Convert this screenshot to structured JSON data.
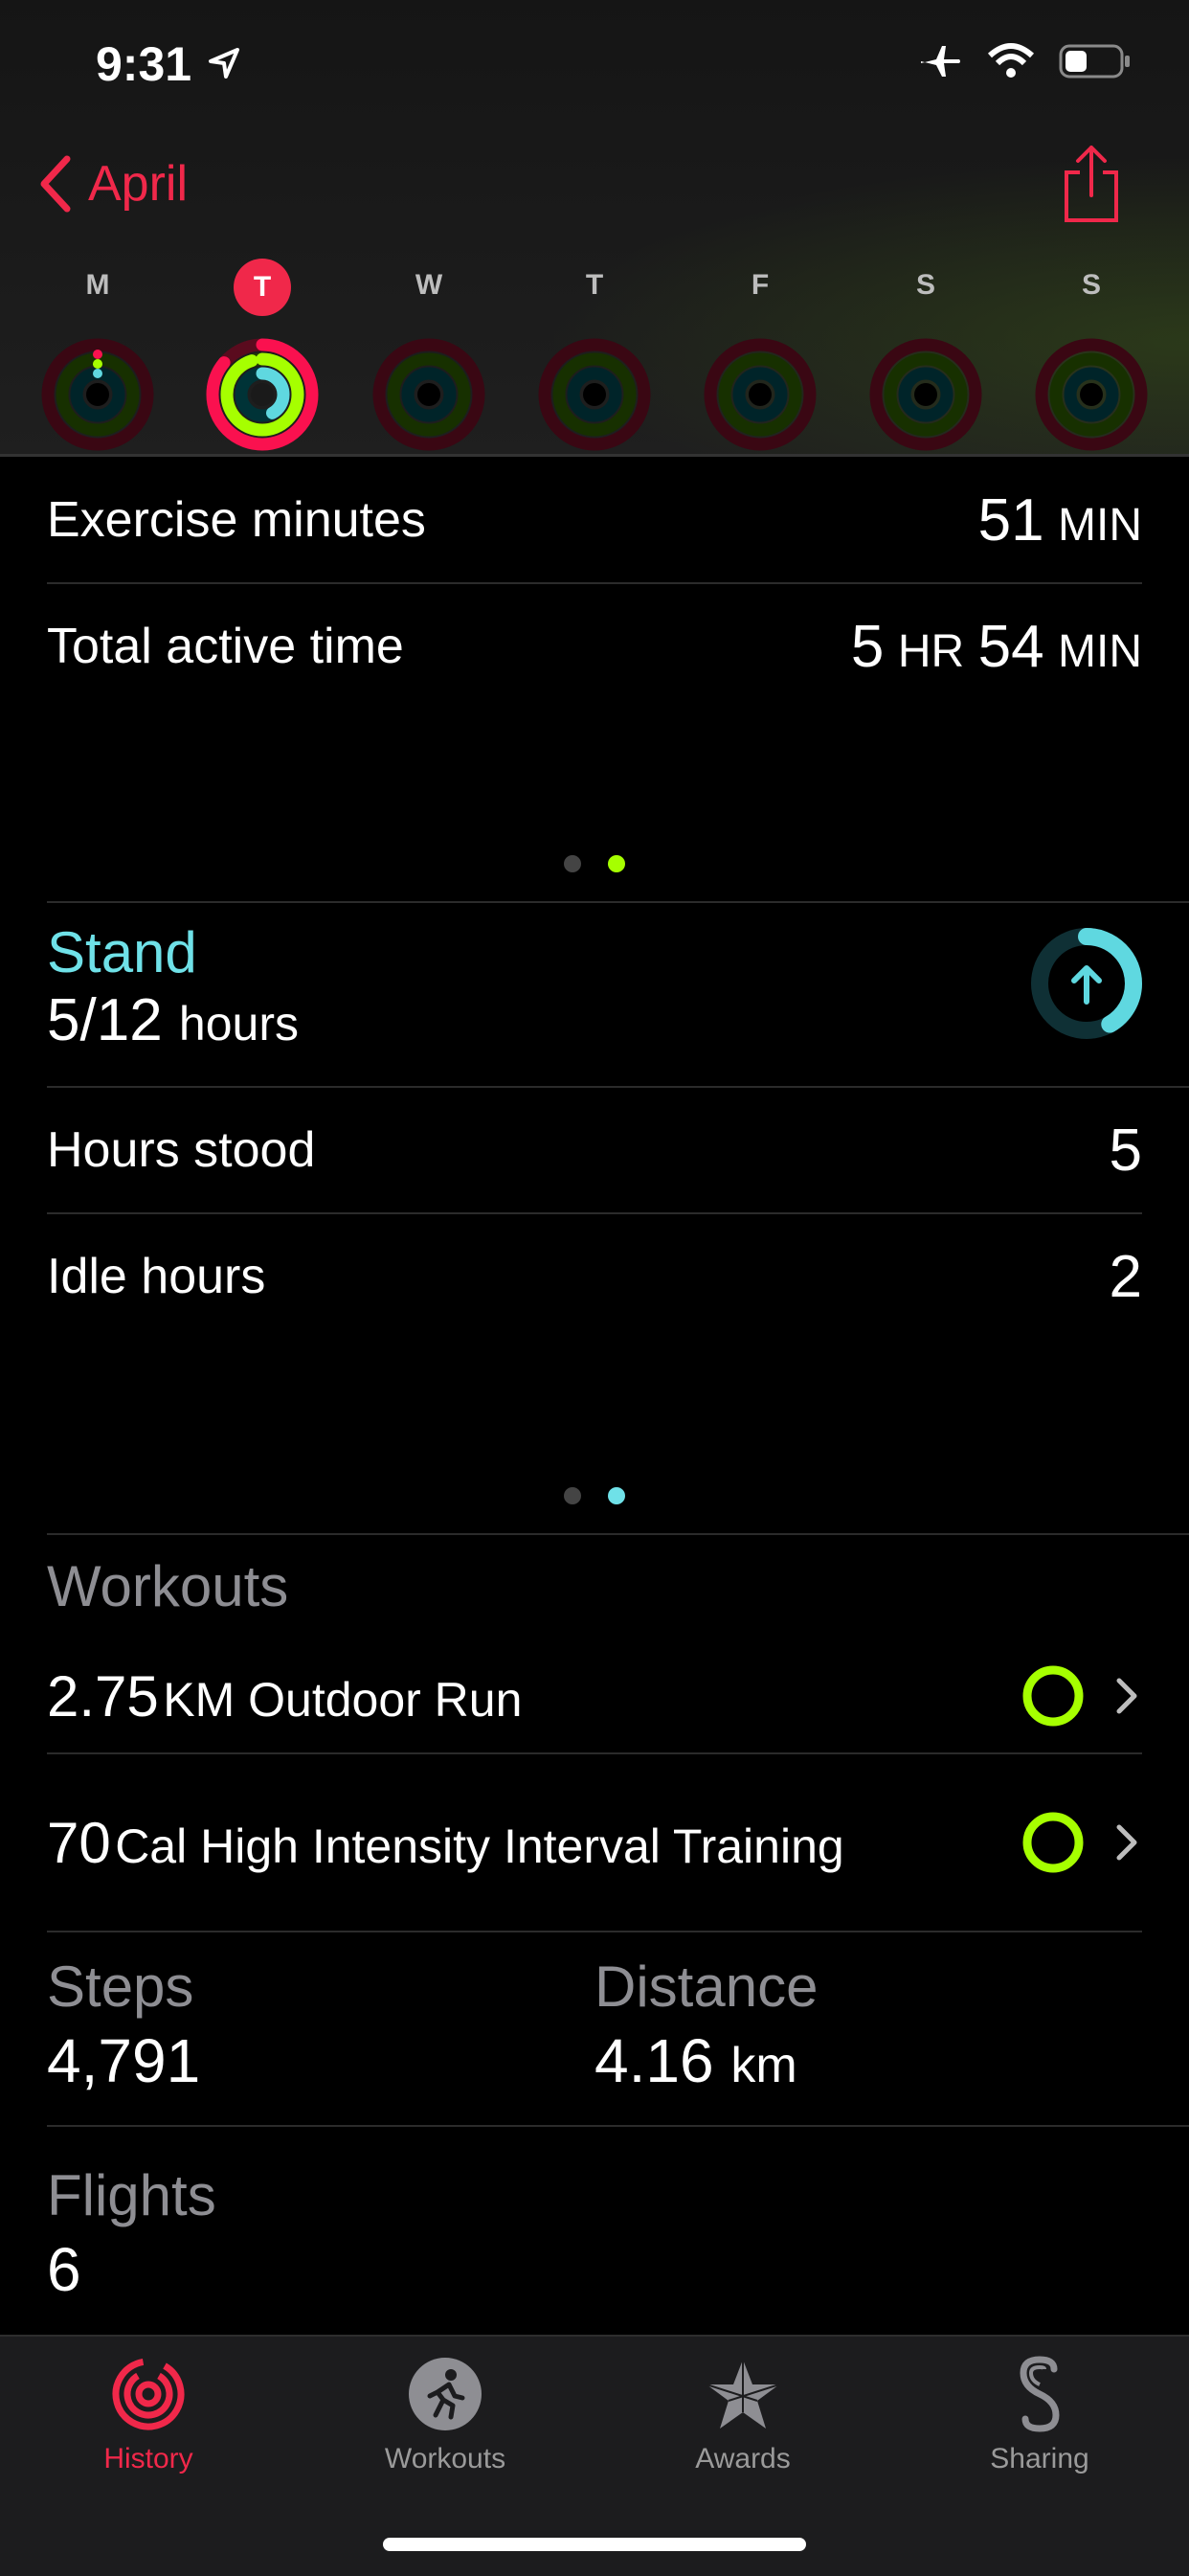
{
  "status": {
    "time": "9:31"
  },
  "nav": {
    "back_label": "April"
  },
  "week": [
    {
      "label": "M",
      "selected": false
    },
    {
      "label": "T",
      "selected": true
    },
    {
      "label": "W",
      "selected": false
    },
    {
      "label": "T",
      "selected": false
    },
    {
      "label": "F",
      "selected": false
    },
    {
      "label": "S",
      "selected": false
    },
    {
      "label": "S",
      "selected": false
    }
  ],
  "exercise": {
    "exercise_label": "Exercise minutes",
    "exercise_value": "51",
    "exercise_unit": "MIN",
    "active_label": "Total active time",
    "active_hr": "5",
    "active_hr_unit": "HR",
    "active_min": "54",
    "active_min_unit": "MIN"
  },
  "stand": {
    "title": "Stand",
    "value": "5/12",
    "unit": "hours",
    "progress": 0.4167,
    "hours_stood_label": "Hours stood",
    "hours_stood": "5",
    "idle_label": "Idle hours",
    "idle": "2"
  },
  "workouts": {
    "title": "Workouts",
    "items": [
      {
        "num": "2.75",
        "text": "KM Outdoor Run"
      },
      {
        "num": "70",
        "text": "Cal High Intensity Interval Training"
      }
    ]
  },
  "stats": {
    "steps_label": "Steps",
    "steps": "4,791",
    "distance_label": "Distance",
    "distance": "4.16",
    "distance_unit": "km",
    "flights_label": "Flights",
    "flights": "6"
  },
  "tabs": [
    {
      "label": "History",
      "icon": "history-rings-icon",
      "active": true
    },
    {
      "label": "Workouts",
      "icon": "runner-icon",
      "active": false
    },
    {
      "label": "Awards",
      "icon": "star-award-icon",
      "active": false
    },
    {
      "label": "Sharing",
      "icon": "sharing-icon",
      "active": false
    }
  ],
  "colors": {
    "accent_red": "#f0284a",
    "move": "#fa114f",
    "exercise": "#a6ff00",
    "stand": "#00e5f0"
  }
}
